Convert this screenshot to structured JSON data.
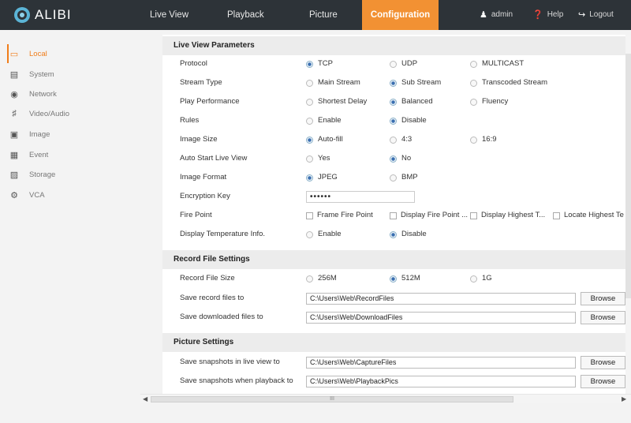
{
  "brand": {
    "logo_text": "ALIBI"
  },
  "nav": {
    "tabs": [
      {
        "label": "Live View"
      },
      {
        "label": "Playback"
      },
      {
        "label": "Picture"
      },
      {
        "label": "Configuration",
        "active": true
      }
    ],
    "user": "admin",
    "help": "Help",
    "logout": "Logout"
  },
  "sidebar": {
    "items": [
      {
        "label": "Local",
        "icon": "monitor-icon",
        "active": true
      },
      {
        "label": "System",
        "icon": "system-icon"
      },
      {
        "label": "Network",
        "icon": "globe-icon"
      },
      {
        "label": "Video/Audio",
        "icon": "video-audio-icon"
      },
      {
        "label": "Image",
        "icon": "image-icon"
      },
      {
        "label": "Event",
        "icon": "calendar-icon"
      },
      {
        "label": "Storage",
        "icon": "storage-icon"
      },
      {
        "label": "VCA",
        "icon": "vca-icon"
      }
    ]
  },
  "live_view": {
    "title": "Live View Parameters",
    "protocol": {
      "label": "Protocol",
      "options": [
        "TCP",
        "UDP",
        "MULTICAST"
      ],
      "selected": "TCP"
    },
    "stream_type": {
      "label": "Stream Type",
      "options": [
        "Main Stream",
        "Sub Stream",
        "Transcoded Stream"
      ],
      "selected": "Sub Stream"
    },
    "play_performance": {
      "label": "Play Performance",
      "options": [
        "Shortest Delay",
        "Balanced",
        "Fluency"
      ],
      "selected": "Balanced"
    },
    "rules": {
      "label": "Rules",
      "options": [
        "Enable",
        "Disable"
      ],
      "selected": "Disable"
    },
    "image_size": {
      "label": "Image Size",
      "options": [
        "Auto-fill",
        "4:3",
        "16:9"
      ],
      "selected": "Auto-fill"
    },
    "auto_start": {
      "label": "Auto Start Live View",
      "options": [
        "Yes",
        "No"
      ],
      "selected": "No"
    },
    "image_format": {
      "label": "Image Format",
      "options": [
        "JPEG",
        "BMP"
      ],
      "selected": "JPEG"
    },
    "encryption_key": {
      "label": "Encryption Key",
      "value": "••••••"
    },
    "fire_point": {
      "label": "Fire Point",
      "options": [
        "Frame Fire Point",
        "Display Fire Point ...",
        "Display Highest T...",
        "Locate Highest Te"
      ]
    },
    "temp_info": {
      "label": "Display Temperature Info.",
      "options": [
        "Enable",
        "Disable"
      ],
      "selected": "Disable"
    }
  },
  "record": {
    "title": "Record File Settings",
    "file_size": {
      "label": "Record File Size",
      "options": [
        "256M",
        "512M",
        "1G"
      ],
      "selected": "512M"
    },
    "save_record": {
      "label": "Save record files to",
      "value": "C:\\Users\\Web\\RecordFiles"
    },
    "save_downloaded": {
      "label": "Save downloaded files to",
      "value": "C:\\Users\\Web\\DownloadFiles"
    }
  },
  "picture": {
    "title": "Picture Settings",
    "snap_live": {
      "label": "Save snapshots in live view to",
      "value": "C:\\Users\\Web\\CaptureFiles"
    },
    "snap_playback": {
      "label": "Save snapshots when playback to",
      "value": "C:\\Users\\Web\\PlaybackPics"
    }
  },
  "browse_label": "Browse",
  "scrollbar_grip": "III",
  "colors": {
    "topbar": "#2d3338",
    "accent": "#f29133",
    "active_text": "#f07d1a"
  }
}
